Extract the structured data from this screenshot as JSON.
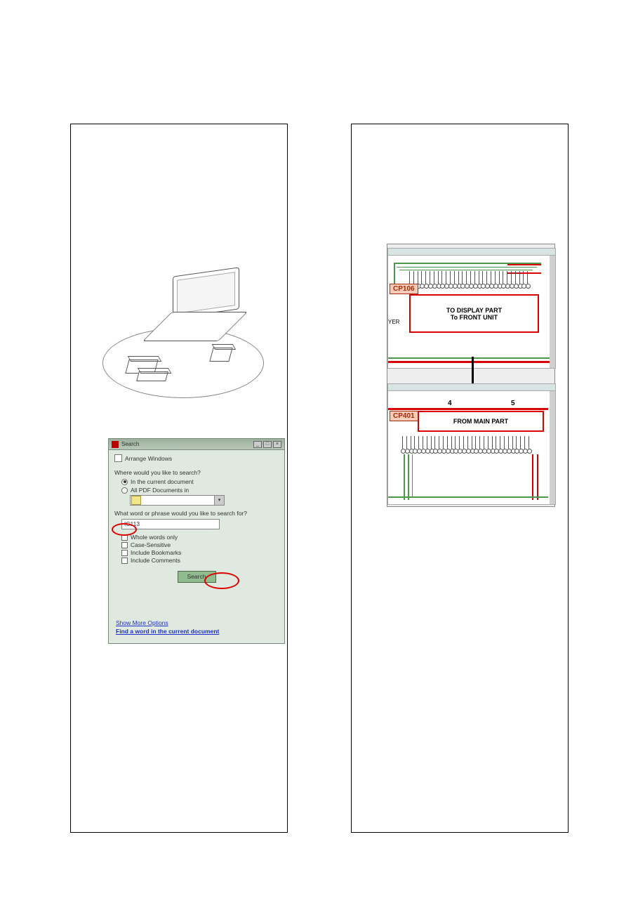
{
  "search_dialog": {
    "title": "Search",
    "arrange_label": "Arrange Windows",
    "where_label": "Where would you like to search?",
    "radio_current": "In the current document",
    "radio_all": "All PDF Documents in",
    "what_label": "What word or phrase would you like to search for?",
    "input_value": "IC113",
    "chk_whole": "Whole words only",
    "chk_case": "Case-Sensitive",
    "chk_bookmarks": "Include Bookmarks",
    "chk_comments": "Include Comments",
    "search_button": "Search",
    "link_more": "Show More Options",
    "link_find": "Find a word in the current document",
    "win_min": "_",
    "win_max": "□",
    "win_close": "×"
  },
  "diagram": {
    "cp_top": "CP106",
    "cp_bot": "CP401",
    "box_top_line1": "TO DISPLAY PART",
    "box_top_line2": "To FRONT UNIT",
    "box_bot_line1": "FROM MAIN PART",
    "yer": "YER",
    "coord4": "4",
    "coord5": "5"
  }
}
